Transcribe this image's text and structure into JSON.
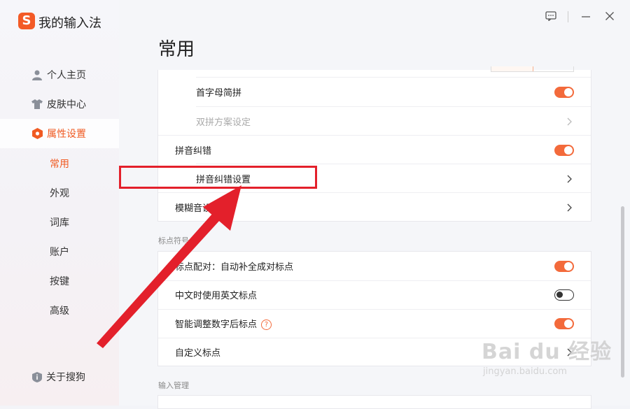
{
  "app": {
    "logo_letter": "S",
    "title": "我的输入法"
  },
  "window_controls": {
    "feedback": "feedback-icon",
    "minimize": "minimize-icon",
    "close": "close-icon"
  },
  "sidebar": {
    "items": [
      {
        "label": "个人主页",
        "icon": "user-icon"
      },
      {
        "label": "皮肤中心",
        "icon": "shirt-icon"
      },
      {
        "label": "属性设置",
        "icon": "hexagon-settings-icon",
        "active": true
      }
    ],
    "sub_items": [
      {
        "label": "常用",
        "active": true
      },
      {
        "label": "外观"
      },
      {
        "label": "词库"
      },
      {
        "label": "账户"
      },
      {
        "label": "按键"
      },
      {
        "label": "高级"
      }
    ],
    "about": {
      "label": "关于搜狗",
      "icon": "info-shield-icon"
    }
  },
  "main": {
    "title": "常用",
    "pinyin_card": {
      "rows": [
        {
          "label": "首字母简拼",
          "control": "toggle",
          "on": true
        },
        {
          "label": "双拼方案设定",
          "control": "chevron",
          "disabled": true
        },
        {
          "label": "拼音纠错",
          "control": "toggle",
          "on": true
        },
        {
          "label": "拼音纠错设置",
          "control": "chevron"
        },
        {
          "label": "模糊音设",
          "control": "chevron"
        }
      ]
    },
    "punct_section_title": "标点符号",
    "punct_card": {
      "rows": [
        {
          "label": "标点配对：自动补全成对标点",
          "control": "toggle",
          "on": true
        },
        {
          "label": "中文时使用英文标点",
          "control": "toggle",
          "on": false
        },
        {
          "label": "智能调整数字后标点",
          "help": "?",
          "control": "toggle",
          "on": true
        },
        {
          "label": "自定义标点",
          "control": "chevron"
        }
      ]
    },
    "input_section_title": "输入管理"
  },
  "colors": {
    "accent": "#f05a22",
    "toggle_on": "#f36a3b",
    "annotation": "#e3202b"
  },
  "watermark": {
    "brand": "Bai du 经验",
    "url": "jingyan.baidu.com"
  }
}
